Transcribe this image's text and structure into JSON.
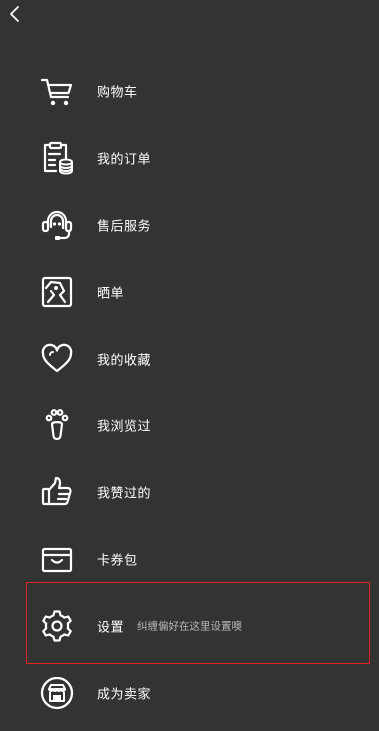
{
  "nav": {
    "back_icon": "chevron-left-icon"
  },
  "menu": {
    "items": [
      {
        "id": "cart",
        "label": "购物车",
        "icon": "cart-icon"
      },
      {
        "id": "orders",
        "label": "我的订单",
        "icon": "order-list-icon"
      },
      {
        "id": "after-sales",
        "label": "售后服务",
        "icon": "headset-icon"
      },
      {
        "id": "share-order",
        "label": "晒单",
        "icon": "photo-icon"
      },
      {
        "id": "favorites",
        "label": "我的收藏",
        "icon": "heart-icon"
      },
      {
        "id": "browsed",
        "label": "我浏览过",
        "icon": "footprint-icon"
      },
      {
        "id": "liked",
        "label": "我赞过的",
        "icon": "thumbs-up-icon"
      },
      {
        "id": "coupons",
        "label": "卡券包",
        "icon": "wallet-icon"
      },
      {
        "id": "settings",
        "label": "设置",
        "hint": "纠缠偏好在这里设置噢",
        "icon": "gear-icon",
        "highlighted": true
      },
      {
        "id": "become-seller",
        "label": "成为卖家",
        "icon": "store-icon"
      }
    ]
  },
  "colors": {
    "background": "#333333",
    "text": "#ffffff",
    "hint_text": "#b8b8b8",
    "highlight_border": "#e02424"
  }
}
